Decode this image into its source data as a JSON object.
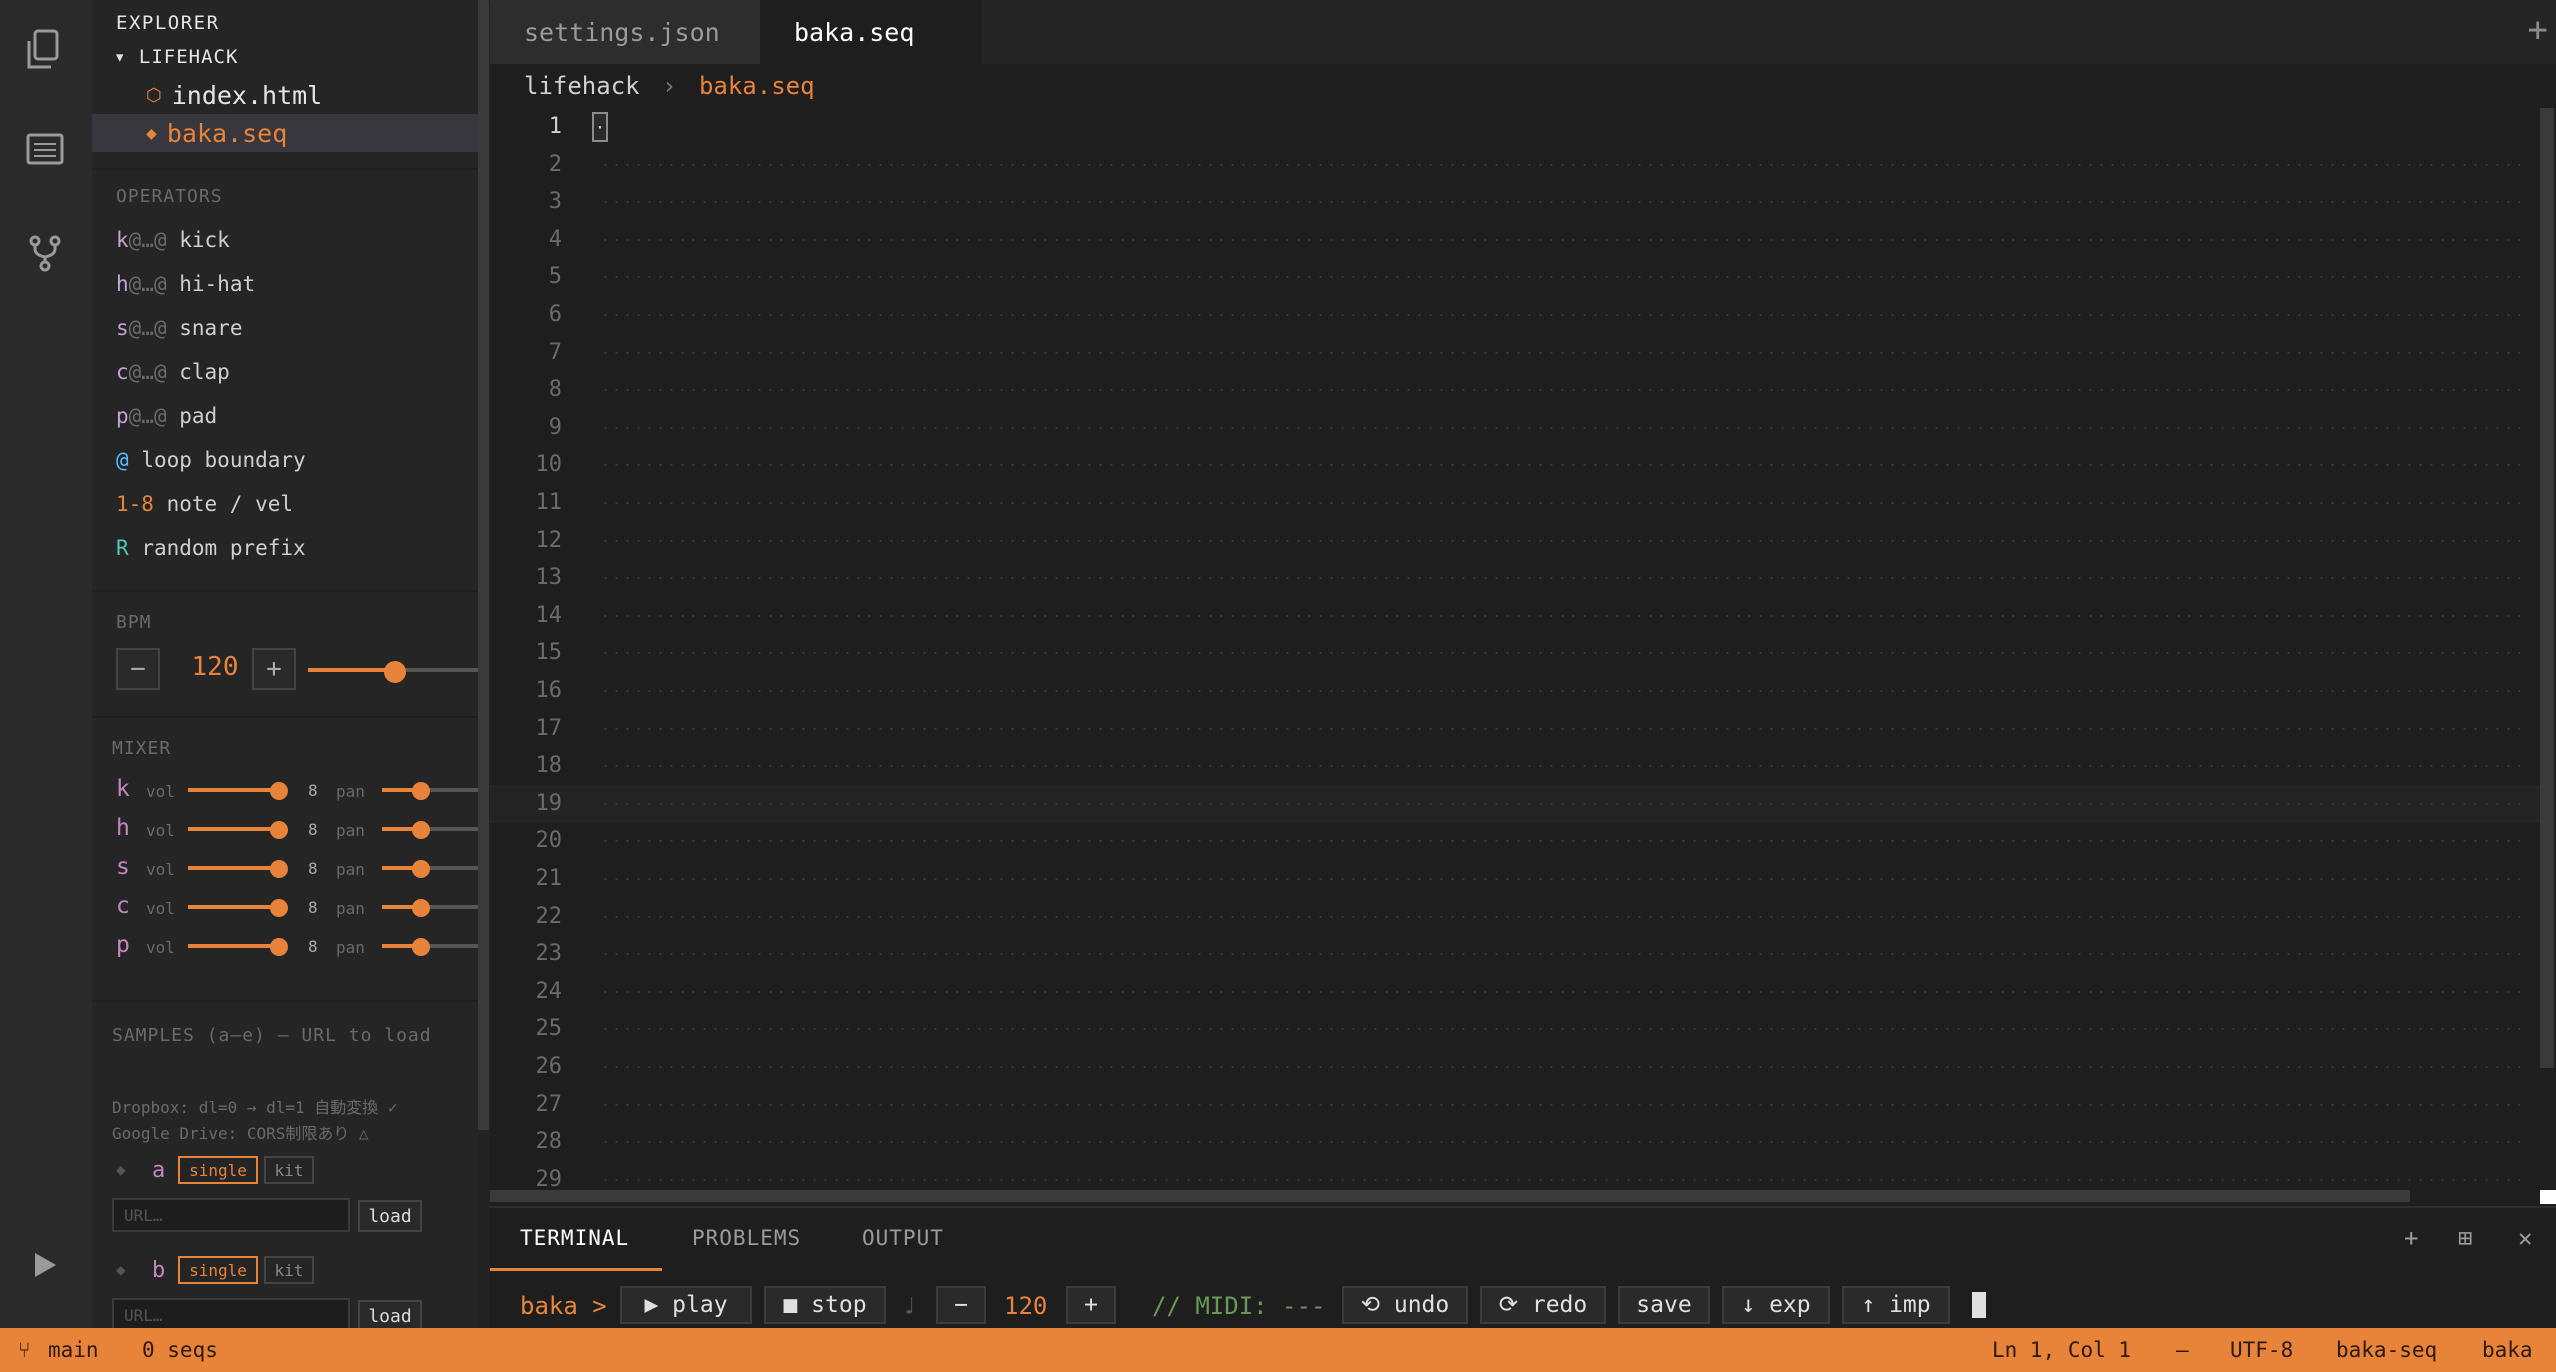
{
  "activity": {
    "icons": [
      "files-icon",
      "list-icon",
      "branch-icon",
      "play-icon"
    ]
  },
  "explorer": {
    "title": "EXPLORER",
    "folder": "▾ LIFEHACK",
    "files": [
      {
        "icon": "⬡",
        "name": "index.html",
        "color": "#e8833a"
      },
      {
        "icon": "◆",
        "name": "baka.seq",
        "color": "#e8833a"
      }
    ]
  },
  "operators": {
    "title": "OPERATORS",
    "items": [
      {
        "key": "k",
        "sym": "@…@",
        "label": "kick",
        "color": "#c8a0d8"
      },
      {
        "key": "h",
        "sym": "@…@",
        "label": "hi-hat",
        "color": "#c8a0d8"
      },
      {
        "key": "s",
        "sym": "@…@",
        "label": "snare",
        "color": "#c8a0d8"
      },
      {
        "key": "c",
        "sym": "@…@",
        "label": "clap",
        "color": "#c8a0d8"
      },
      {
        "key": "p",
        "sym": "@…@",
        "label": "pad",
        "color": "#c8a0d8"
      },
      {
        "key": "@",
        "sym": "",
        "label": "loop boundary",
        "color": "#4fc1ff"
      },
      {
        "key": "1-8",
        "sym": "",
        "label": "note / vel",
        "color": "#e8833a"
      },
      {
        "key": "R",
        "sym": "",
        "label": "random prefix",
        "color": "#4ec9b0"
      }
    ]
  },
  "bpm": {
    "title": "BPM",
    "minus": "−",
    "value": "120",
    "plus": "+",
    "slider_level": 0.5
  },
  "mixer": {
    "title": "MIXER",
    "vol_label": "vol",
    "pan_label": "pan",
    "channels": [
      {
        "ch": "k",
        "value": "8",
        "color": "#c586c0"
      },
      {
        "ch": "h",
        "value": "8",
        "color": "#c586c0"
      },
      {
        "ch": "s",
        "value": "8",
        "color": "#c586c0"
      },
      {
        "ch": "c",
        "value": "8",
        "color": "#c586c0"
      },
      {
        "ch": "p",
        "value": "8",
        "color": "#c586c0"
      }
    ]
  },
  "samples": {
    "title": "SAMPLES (a–e) — URL to load",
    "note1": "Dropbox: dl=0 → dl=1 自動変換 ✓",
    "note2": "Google Drive: CORS制限あり △",
    "rows": [
      {
        "letter": "a",
        "single": "single",
        "kit": "kit",
        "placeholder": "URL…",
        "load": "load"
      },
      {
        "letter": "b",
        "single": "single",
        "kit": "kit",
        "placeholder": "URL…",
        "load": "load"
      }
    ]
  },
  "tabs": [
    {
      "label": "settings.json",
      "active": false
    },
    {
      "label": "baka.seq",
      "active": true
    }
  ],
  "tab_add": "+",
  "breadcrumb": {
    "root": "lifehack",
    "sep": "›",
    "file": "baka.seq"
  },
  "editor": {
    "line_count": 28,
    "current_line": 1,
    "highlight_line": 19,
    "cursor_char": "·"
  },
  "panel": {
    "tabs": [
      "TERMINAL",
      "PROBLEMS",
      "OUTPUT"
    ],
    "controls": [
      "+",
      "⊞",
      "✕"
    ]
  },
  "terminal": {
    "prompt": "baka >",
    "play": "▶ play",
    "stop": "■ stop",
    "note_icon": "♩",
    "minus": "−",
    "bpm": "120",
    "plus": "+",
    "midi": "// MIDI: ---",
    "undo": "⟲ undo",
    "redo": "⟳ redo",
    "save": "save",
    "exp": "↓ exp",
    "imp": "↑ imp"
  },
  "status": {
    "branch_icon": "⑂",
    "branch": "main",
    "seqs": "0 seqs",
    "position": "Ln 1, Col 1",
    "dash": "—",
    "encoding": "UTF-8",
    "language": "baka-seq",
    "user": "baka"
  }
}
